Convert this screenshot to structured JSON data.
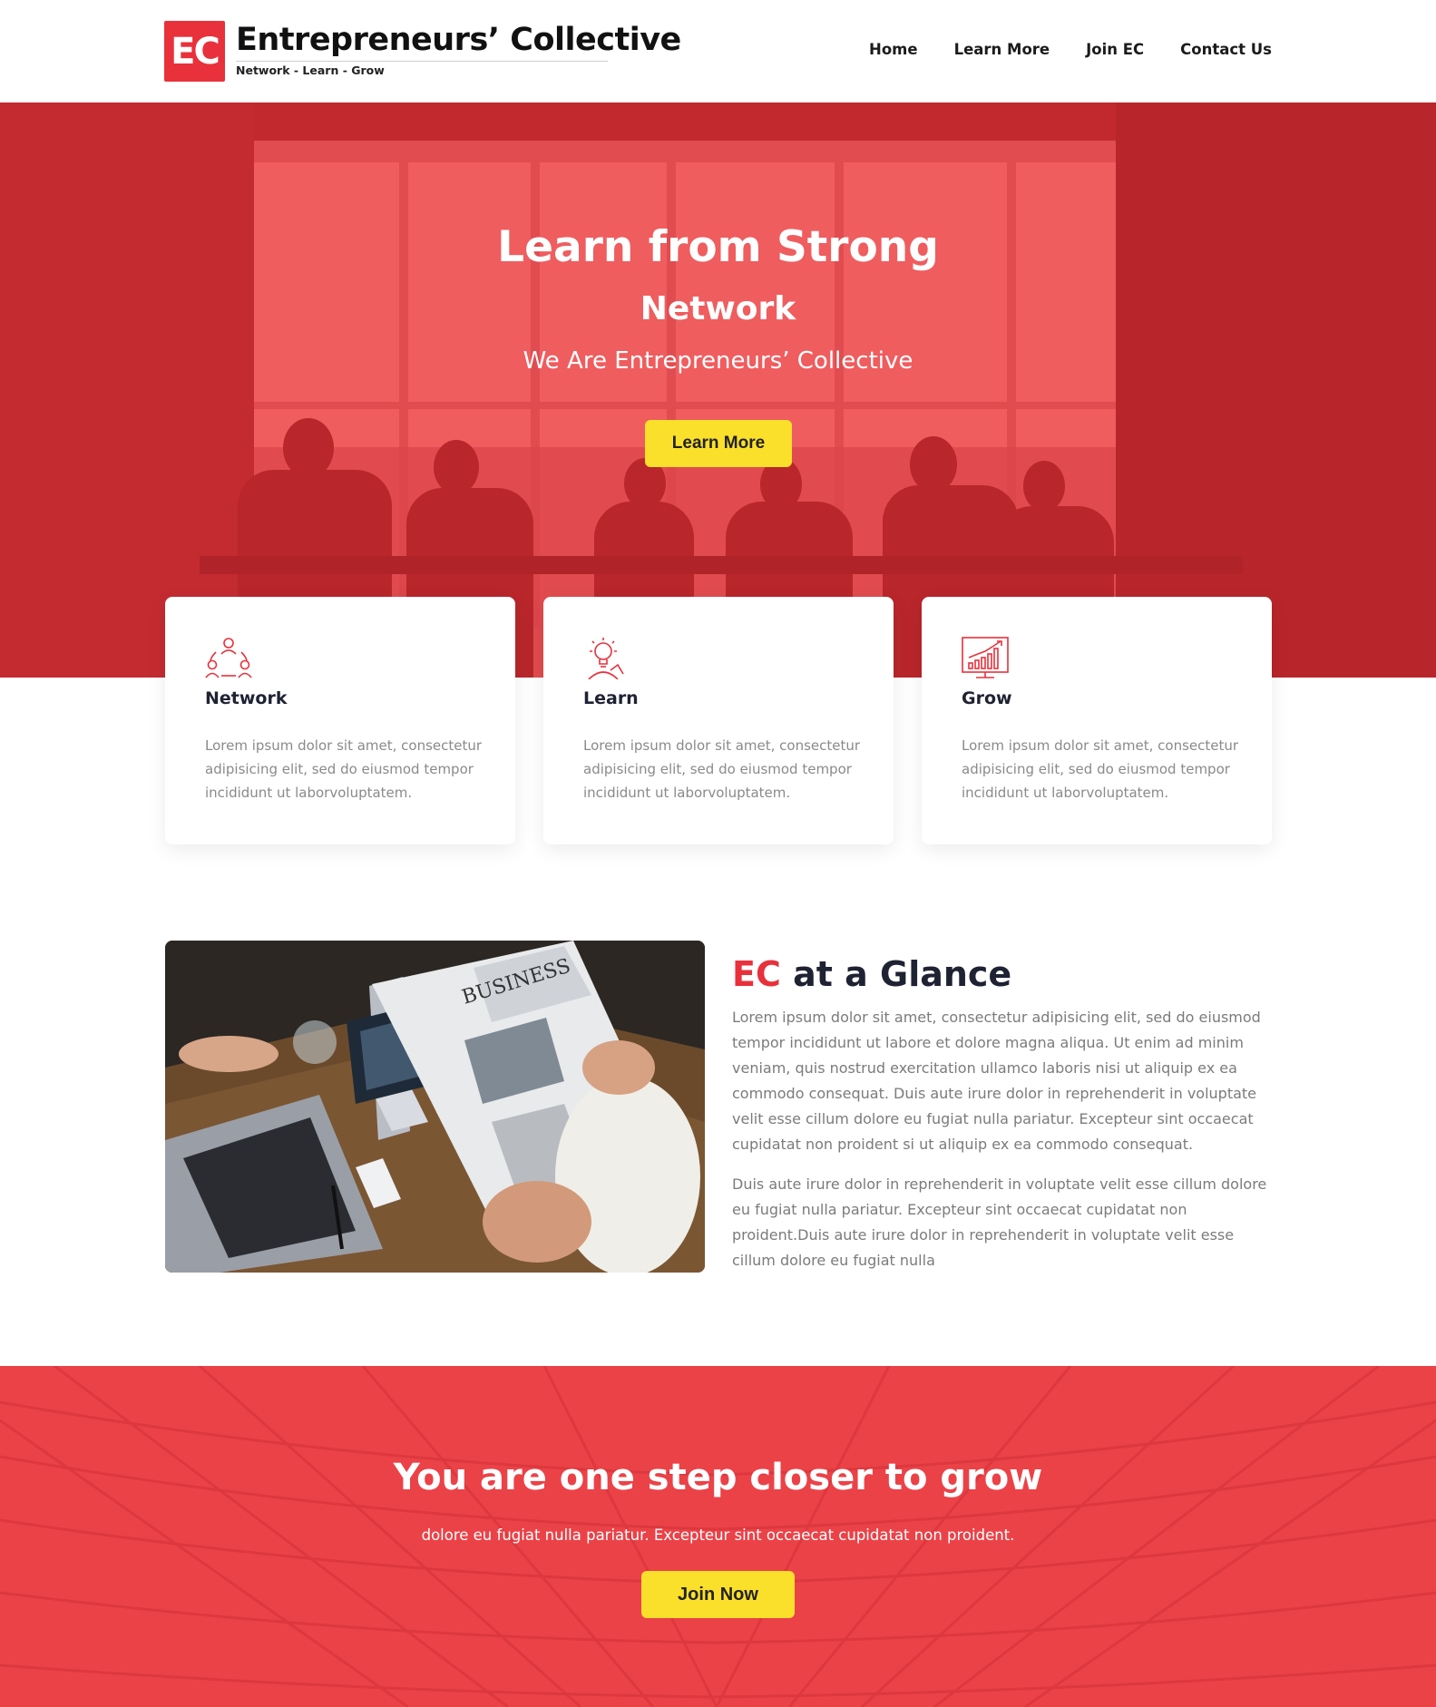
{
  "brand": {
    "mark": "EC",
    "name": "Entrepreneurs’ Collective",
    "tagline": "Network - Learn - Grow",
    "accent": "#e8313b",
    "yellow": "#fbe02b"
  },
  "nav": {
    "items": [
      {
        "label": "Home"
      },
      {
        "label": "Learn More"
      },
      {
        "label": "Join EC"
      },
      {
        "label": "Contact Us"
      }
    ]
  },
  "hero": {
    "title": "Learn from Strong",
    "subtitle": "Network",
    "tagline": "We Are Entrepreneurs’ Collective",
    "button": "Learn More"
  },
  "features": [
    {
      "icon": "network-icon",
      "title": "Network",
      "text": "Lorem ipsum dolor sit amet, consectetur adipisicing elit, sed do eiusmod tempor incididunt ut laborvoluptatem."
    },
    {
      "icon": "lightbulb-icon",
      "title": "Learn",
      "text": "Lorem ipsum dolor sit amet, consectetur adipisicing elit, sed do eiusmod tempor incididunt ut laborvoluptatem."
    },
    {
      "icon": "growth-chart-icon",
      "title": "Grow",
      "text": "Lorem ipsum dolor sit amet, consectetur adipisicing elit, sed do eiusmod tempor incididunt ut laborvoluptatem."
    }
  ],
  "about": {
    "title_accent": "EC",
    "title_rest": " at a Glance",
    "paragraph1": "Lorem ipsum dolor sit amet, consectetur adipisicing elit, sed do eiusmod tempor incididunt ut labore et dolore magna aliqua. Ut enim ad minim veniam, quis nostrud exercitation ullamco laboris nisi ut aliquip ex ea commodo consequat. Duis aute irure dolor in reprehenderit in voluptate velit esse cillum dolore eu fugiat nulla pariatur. Excepteur sint occaecat cupidatat non proident si ut aliquip ex ea commodo consequat.",
    "paragraph2": "Duis aute irure dolor in reprehenderit in voluptate velit esse cillum dolore eu fugiat nulla pariatur. Excepteur sint occaecat cupidatat non proident.Duis aute irure dolor in reprehenderit in voluptate velit esse cillum dolore eu fugiat nulla",
    "image": {
      "newspaper_headline": "BUSINESS"
    }
  },
  "cta": {
    "title": "You are one step closer to grow",
    "text": "dolore eu fugiat nulla pariatur. Excepteur sint occaecat cupidatat non proident.",
    "button": "Join Now"
  }
}
